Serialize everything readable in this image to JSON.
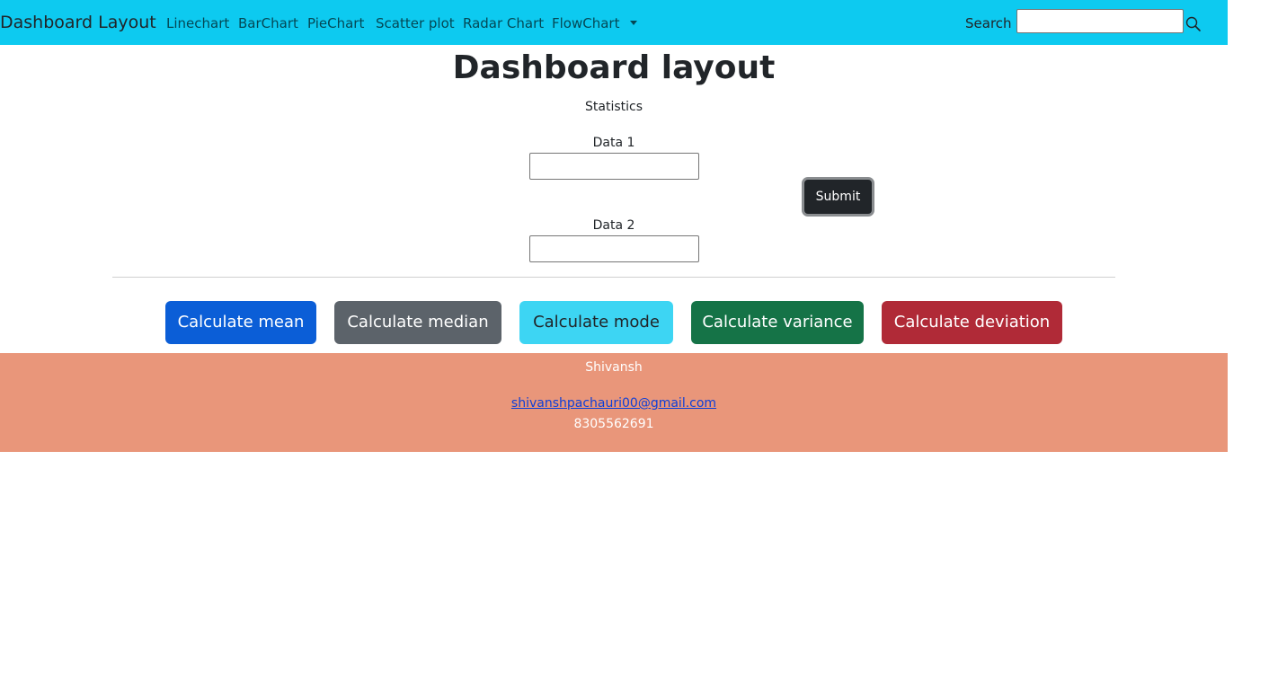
{
  "navbar": {
    "brand": "Dashboard Layout",
    "items": [
      {
        "label": "Linechart"
      },
      {
        "label": "BarChart"
      },
      {
        "label": "PieChart"
      },
      {
        "label": "Scatter plot"
      },
      {
        "label": "Radar Chart"
      },
      {
        "label": "FlowChart"
      }
    ],
    "dropdown_icon": "caret-down-icon",
    "search_label": "Search",
    "search_value": "",
    "search_icon": "search-icon",
    "background_color": "#0dcaf0"
  },
  "main": {
    "title": "Dashboard layout",
    "subtitle": "Statistics",
    "data1_label": "Data 1",
    "data1_value": "",
    "data2_label": "Data 2",
    "data2_value": "",
    "submit_label": "Submit"
  },
  "calc_buttons": [
    {
      "label": "Calculate mean",
      "color": "#0b5ed7"
    },
    {
      "label": "Calculate median",
      "color": "#5c636a"
    },
    {
      "label": "Calculate mode",
      "color": "#3dd5f3"
    },
    {
      "label": "Calculate variance",
      "color": "#157347"
    },
    {
      "label": "Calculate deviation",
      "color": "#b02a37"
    }
  ],
  "footer": {
    "name": "Shivansh",
    "email": "shivanshpachauri00@gmail.com",
    "phone": "8305562691",
    "background_color": "#e9967a"
  }
}
